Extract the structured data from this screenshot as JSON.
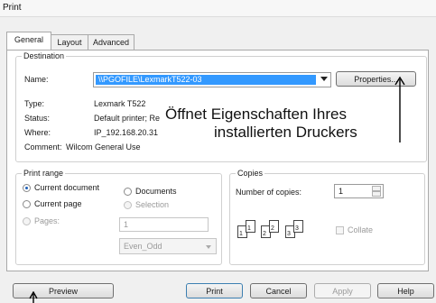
{
  "window": {
    "title": "Print"
  },
  "tabs": [
    {
      "label": "General"
    },
    {
      "label": "Layout"
    },
    {
      "label": "Advanced"
    }
  ],
  "destination": {
    "legend": "Destination",
    "name_label": "Name:",
    "name_value": "\\\\PGOFILE\\LexmarkT522-03",
    "properties_button": "Properties...",
    "type_label": "Type:",
    "type_value": "Lexmark T522",
    "status_label": "Status:",
    "status_value": "Default printer; Re",
    "where_label": "Where:",
    "where_value": "IP_192.168.20.31",
    "comment_label": "Comment:",
    "comment_value": "Wilcom General Use"
  },
  "callout": {
    "line1": "Öffnet Eigenschaften Ihres",
    "line2": "installierten Druckers"
  },
  "print_range": {
    "legend": "Print range",
    "current_document": "Current document",
    "documents": "Documents",
    "current_page": "Current page",
    "selection": "Selection",
    "pages": "Pages:",
    "pages_value": "1",
    "even_odd": "Even_Odd"
  },
  "copies": {
    "legend": "Copies",
    "number_label": "Number of copies:",
    "number_value": "1",
    "collate": "Collate",
    "page_numbers": [
      "1",
      "1",
      "2",
      "2",
      "3",
      "3"
    ]
  },
  "buttons": {
    "preview": "Preview",
    "print": "Print",
    "cancel": "Cancel",
    "apply": "Apply",
    "help": "Help"
  }
}
